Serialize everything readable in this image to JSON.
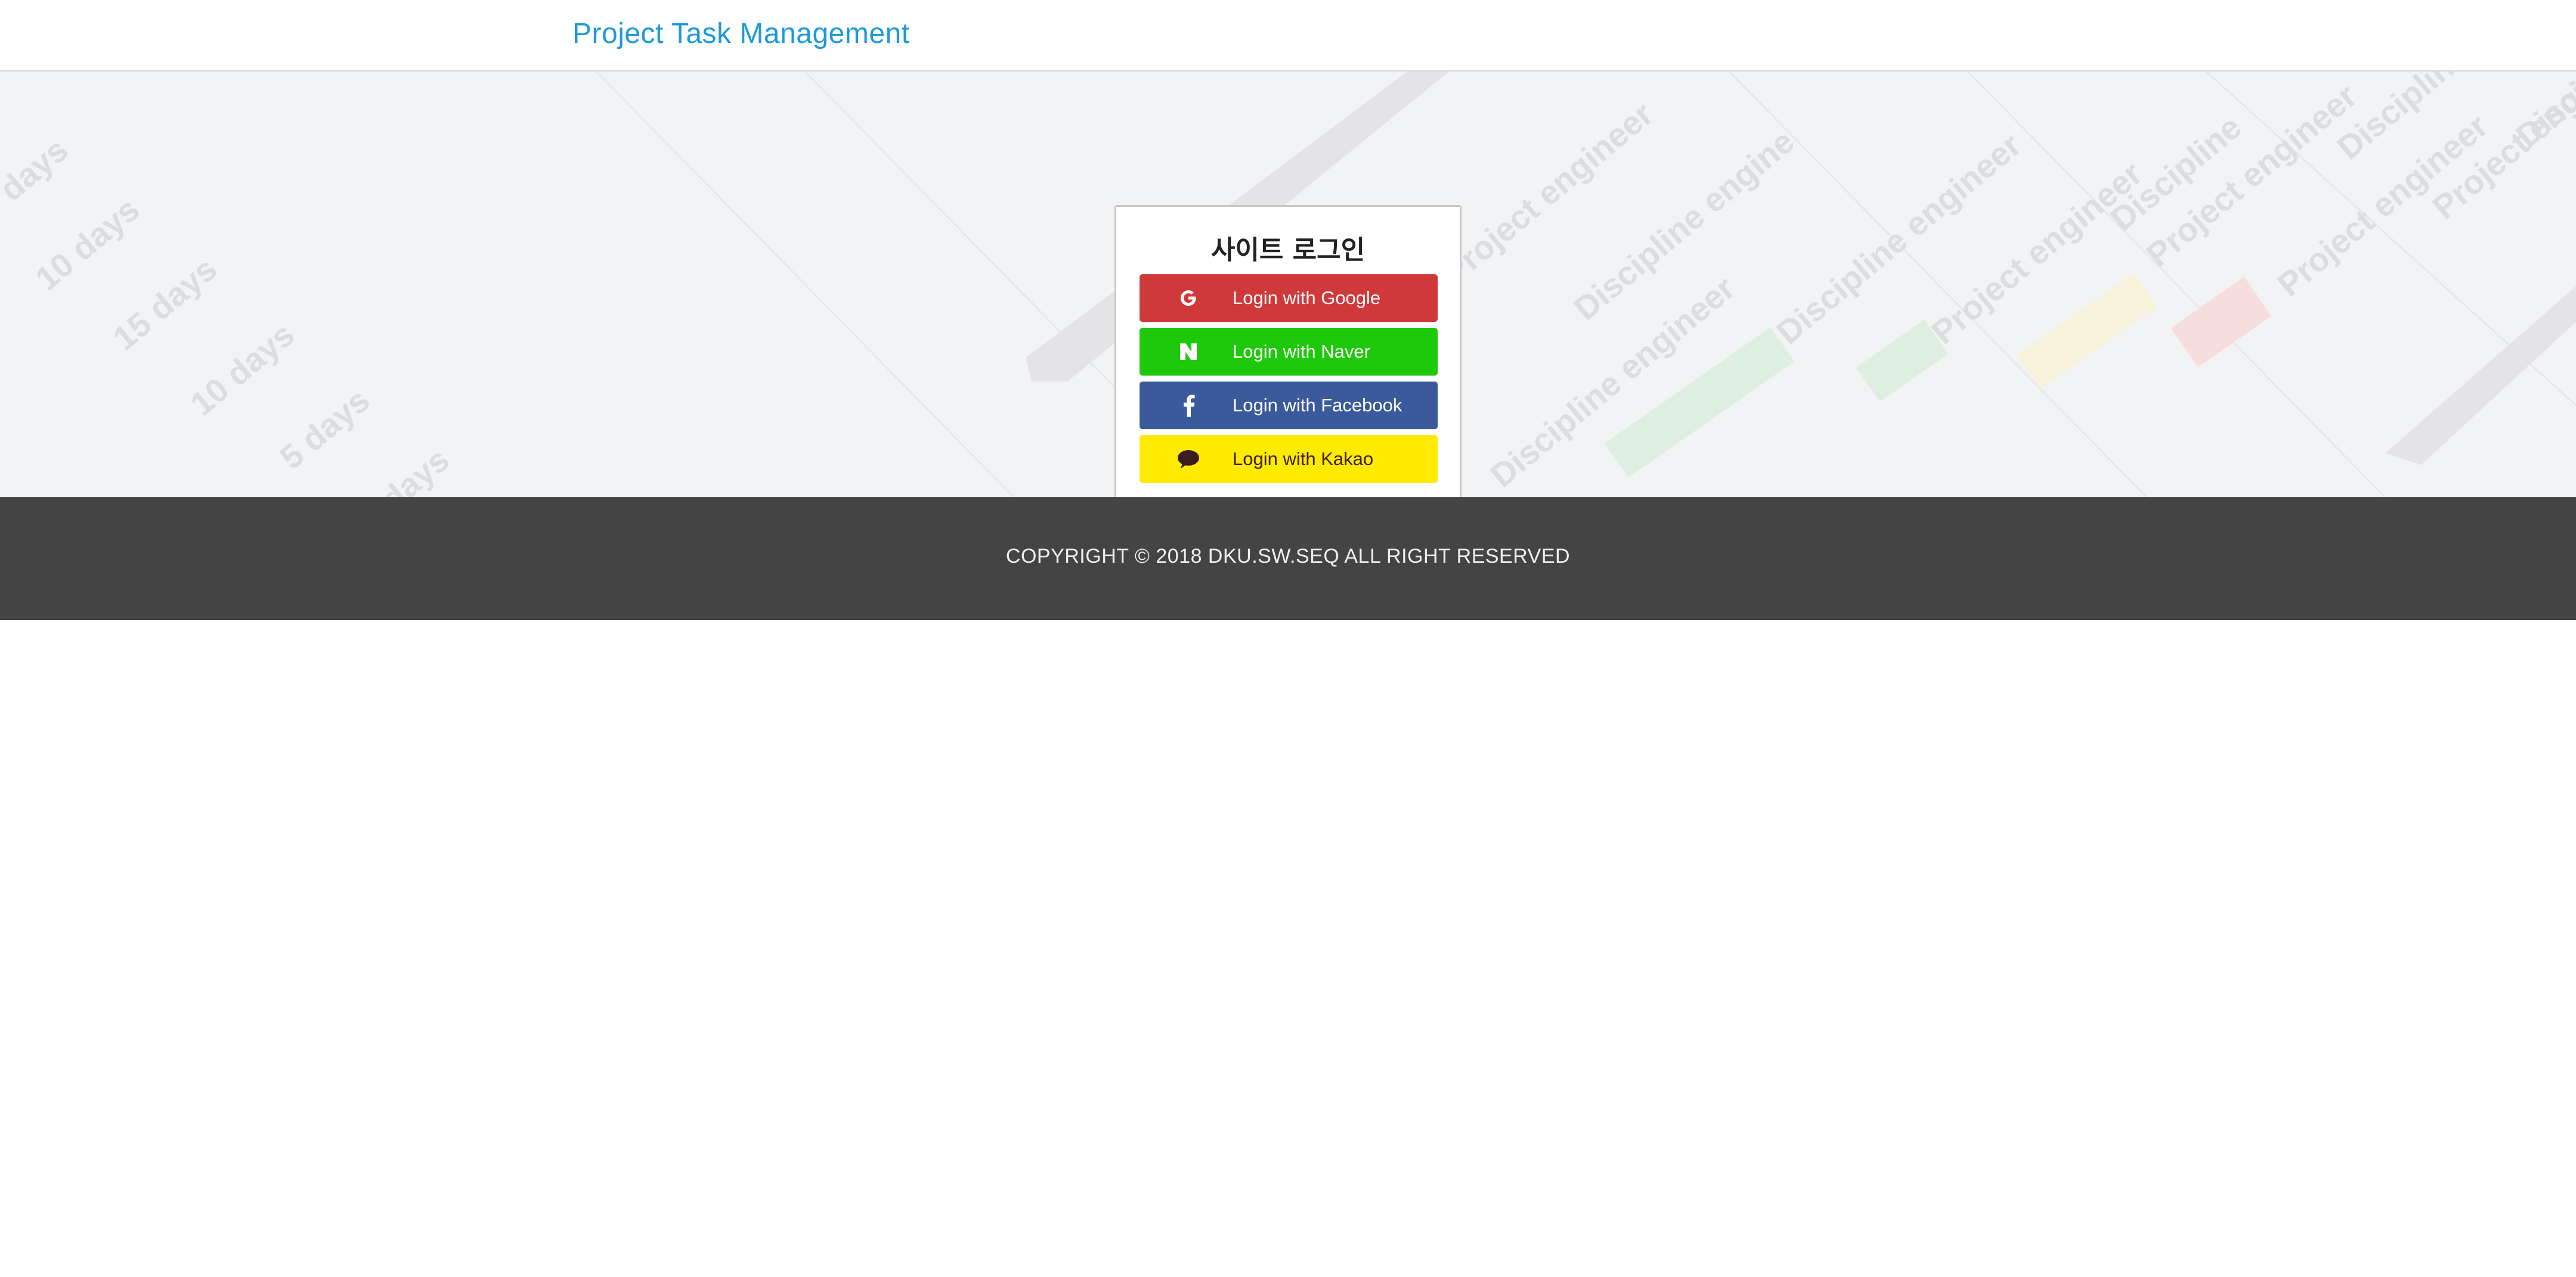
{
  "header": {
    "brand": "Project Task Management",
    "brand_color": "#1f9ad8"
  },
  "login": {
    "title": "사이트 로그인",
    "buttons": [
      {
        "label": "Login with Google",
        "icon": "google-icon",
        "color": "#d0393a"
      },
      {
        "label": "Login with Naver",
        "icon": "naver-icon",
        "color": "#1ec80a"
      },
      {
        "label": "Login with Facebook",
        "icon": "facebook-icon",
        "color": "#3b5a9b"
      },
      {
        "label": "Login with Kakao",
        "icon": "kakao-icon",
        "color": "#ffeb00"
      }
    ]
  },
  "background_labels": {
    "durations": [
      "days",
      "10 days",
      "15 days",
      "10 days",
      "5 days",
      "10 days",
      "days"
    ],
    "roles": [
      "Project engineer",
      "Discipline engine",
      "Discipline engineer",
      "Discipline engineer",
      "Project engineer",
      "Discipline",
      "Project engineer",
      "Project engineer",
      "Discipline",
      "Project engineer",
      "Discipline"
    ]
  },
  "footer": {
    "copyright": "COPYRIGHT © 2018 DKU.SW.SEQ ALL RIGHT RESERVED",
    "background": "#444444"
  }
}
